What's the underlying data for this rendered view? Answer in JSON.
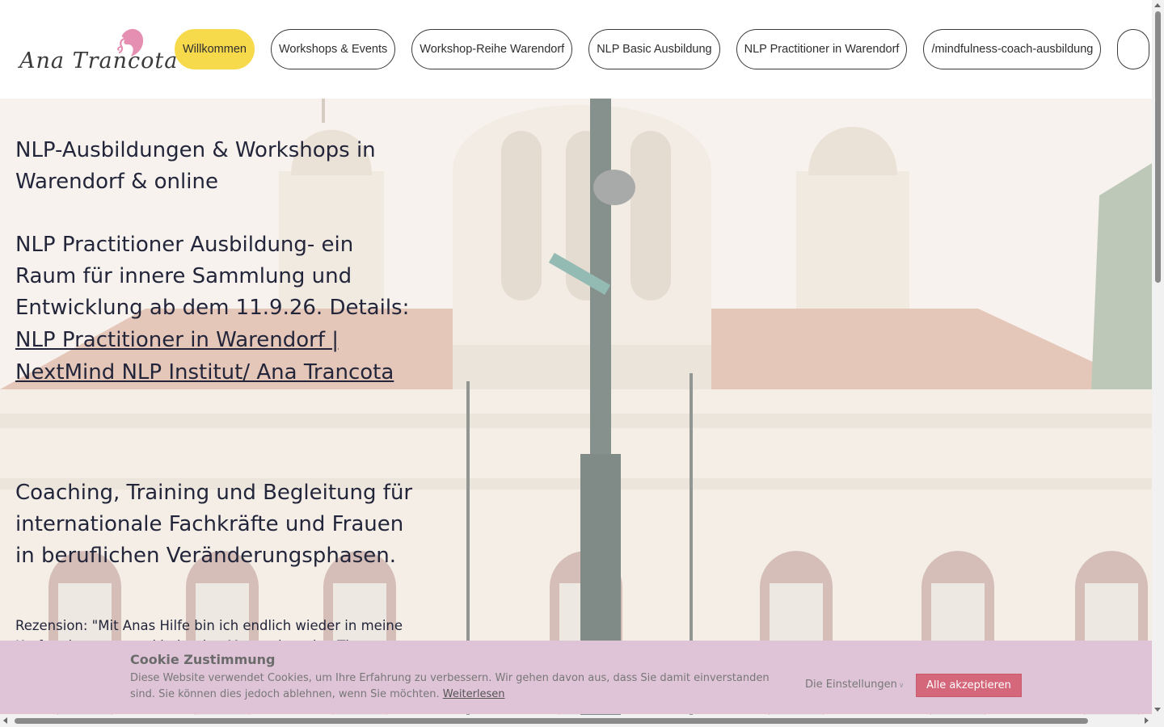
{
  "brand": {
    "name": "Ana Trancota",
    "accent_color": "#f7d94c",
    "logo_color": "#e58fb2"
  },
  "nav": {
    "items": [
      {
        "label": "Willkommen",
        "active": true
      },
      {
        "label": "Workshops & Events",
        "active": false
      },
      {
        "label": "Workshop-Reihe Warendorf",
        "active": false
      },
      {
        "label": "NLP Basic Ausbildung",
        "active": false
      },
      {
        "label": "NLP Practitioner in Warendorf",
        "active": false
      },
      {
        "label": "/mindfulness-coach-ausbildung",
        "active": false
      }
    ]
  },
  "hero": {
    "heading_line1": "NLP-Ausbildungen & Workshops in Warendorf & online",
    "practitioner_text": "NLP Practitioner Ausbildung- ein Raum für innere Sammlung und Entwicklung ab dem 11.9.26. Details:",
    "practitioner_link": "NLP Practitioner in Warendorf | NextMind NLP Institut/ Ana Trancota",
    "coaching_heading": "Coaching, Training und Begleitung für internationale Fachkräfte und Frauen in beruflichen Veränderungsphasen.",
    "review": "Rezension: \"Mit Anas Hilfe bin ich endlich wieder in meine Kraft gekommen und habe den Mut , mir meine Themen"
  },
  "cookie": {
    "title": "Cookie Zustimmung",
    "text": "Diese Website verwendet Cookies, um Ihre Erfahrung zu verbessern. Wir gehen davon aus, dass Sie damit einverstanden sind. Sie können dies jedoch ablehnen, wenn Sie möchten.",
    "read_more": "Weiterlesen",
    "settings_label": "Die Einstellungen",
    "accept_label": "Alle akzeptieren",
    "background_color": "#dfc4d8",
    "accept_color": "#d5677a"
  }
}
